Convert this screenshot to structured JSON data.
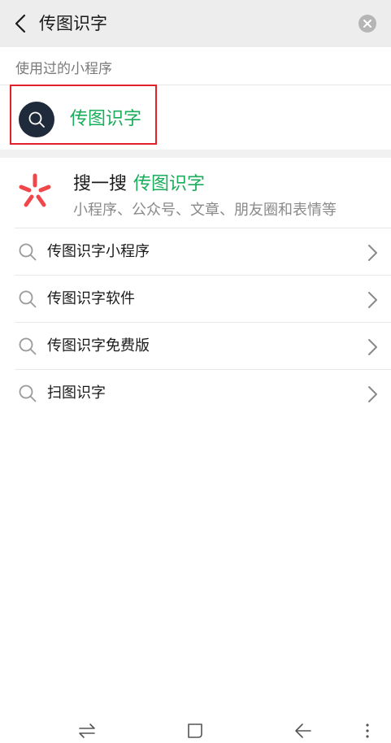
{
  "search": {
    "query": "传图识字"
  },
  "recent": {
    "section_label": "使用过的小程序",
    "item": {
      "name": "传图识字",
      "icon": "search-icon"
    }
  },
  "sousou": {
    "title": "搜一搜",
    "keyword": "传图识字",
    "subtitle": "小程序、公众号、文章、朋友圈和表情等"
  },
  "suggestions": [
    {
      "text": "传图识字小程序"
    },
    {
      "text": "传图识字软件"
    },
    {
      "text": "传图识字免费版"
    },
    {
      "text": "扫图识字"
    }
  ],
  "colors": {
    "accent_green": "#1aad5b",
    "highlight_red": "#e0202a",
    "topbar_bg": "#ededed"
  },
  "navbar": {
    "icons": [
      "recent-apps-icon",
      "home-icon",
      "back-arrow-icon",
      "menu-dots-icon"
    ]
  }
}
